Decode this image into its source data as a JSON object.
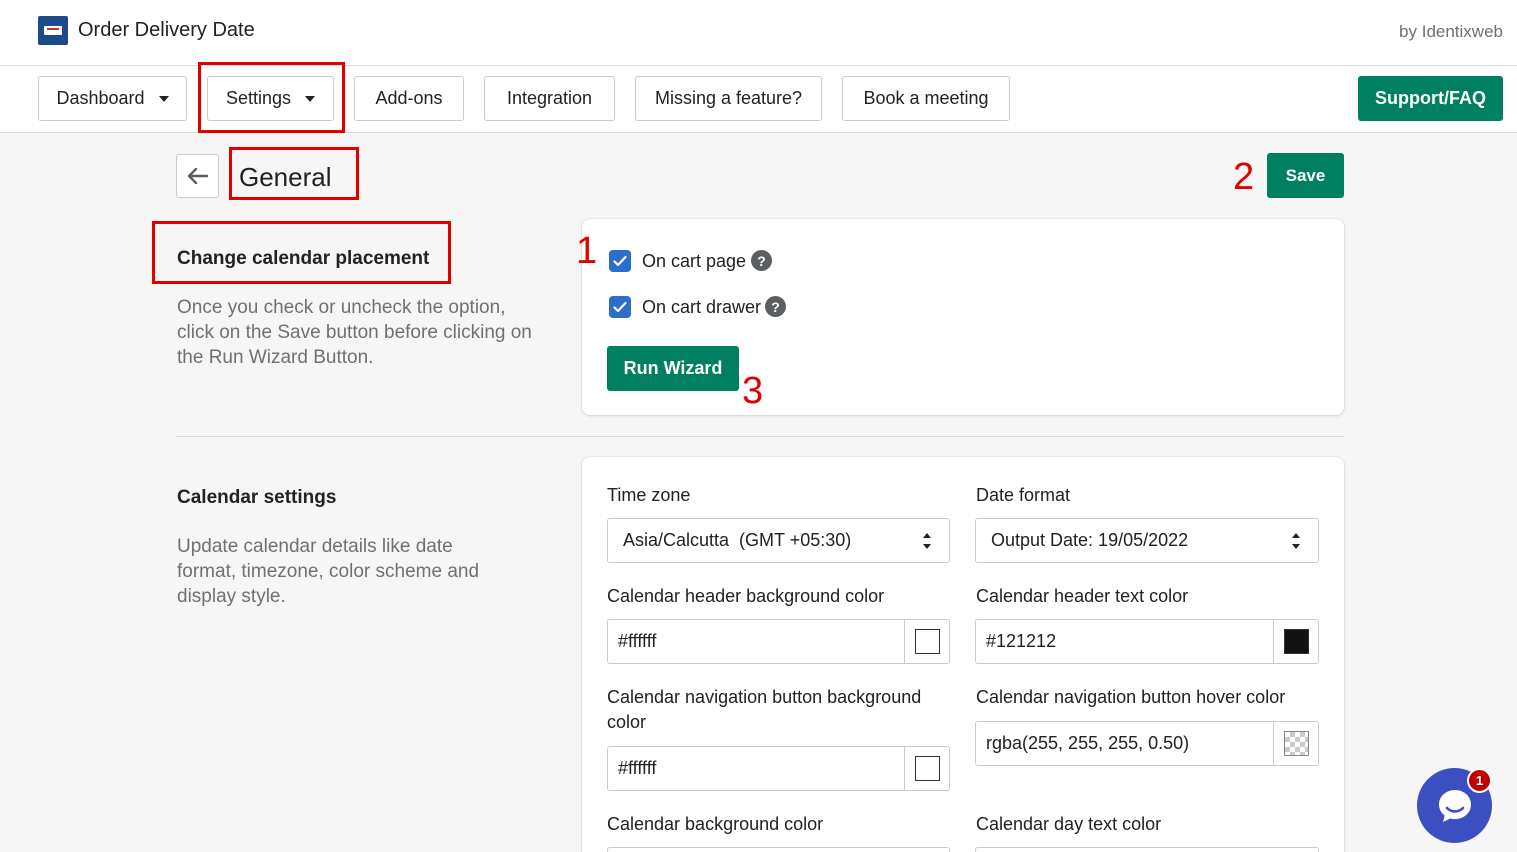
{
  "app": {
    "title": "Order Delivery Date",
    "by": "by Identixweb"
  },
  "nav": {
    "dashboard": "Dashboard",
    "settings": "Settings",
    "addons": "Add-ons",
    "integration": "Integration",
    "missing": "Missing a feature?",
    "meeting": "Book a meeting",
    "support": "Support/FAQ"
  },
  "page": {
    "title": "General",
    "save_label": "Save"
  },
  "annotations": {
    "n1": "1",
    "n2": "2",
    "n3": "3"
  },
  "placement": {
    "title": "Change calendar placement",
    "description": "Once you check or uncheck the option, click on the Save button before clicking on the Run Wizard Button.",
    "cart_page": "On cart page",
    "cart_drawer": "On cart drawer",
    "run_wizard": "Run Wizard"
  },
  "calendar": {
    "title": "Calendar settings",
    "description": "Update calendar details like date format, timezone, color scheme and display style.",
    "timezone_label": "Time zone",
    "timezone_value": "Asia/Calcutta  (GMT +05:30)",
    "date_format_label": "Date format",
    "date_format_value": "Output Date: 19/05/2022",
    "header_bg_label": "Calendar header background color",
    "header_bg_value": "#ffffff",
    "header_text_label": "Calendar header text color",
    "header_text_value": "#121212",
    "nav_bg_label": "Calendar navigation button background color",
    "nav_bg_value": "#ffffff",
    "nav_hover_label": "Calendar navigation button hover color",
    "nav_hover_value": "rgba(255, 255, 255, 0.50)",
    "bg_label": "Calendar background color",
    "day_text_label": "Calendar day text color"
  },
  "chat": {
    "badge": "1"
  },
  "colors": {
    "accent": "#008060",
    "checkbox": "#2c6ecb",
    "annotation": "#e00000",
    "chat": "#3b4fc0"
  }
}
